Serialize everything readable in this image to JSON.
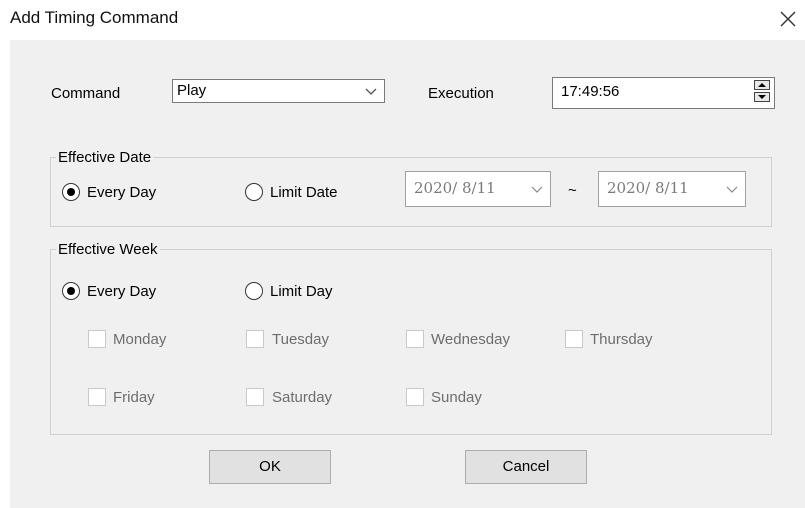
{
  "window": {
    "title": "Add Timing Command"
  },
  "command": {
    "label": "Command",
    "value": "Play"
  },
  "execution": {
    "label": "Execution",
    "value": "17:49:56"
  },
  "effective_date": {
    "legend": "Effective Date",
    "every_day_label": "Every Day",
    "limit_date_label": "Limit Date",
    "selected": "every_day",
    "start_date": "2020/  8/11",
    "separator": "~",
    "end_date": "2020/  8/11"
  },
  "effective_week": {
    "legend": "Effective Week",
    "every_day_label": "Every Day",
    "limit_day_label": "Limit Day",
    "selected": "every_day",
    "days": [
      "Monday",
      "Tuesday",
      "Wednesday",
      "Thursday",
      "Friday",
      "Saturday",
      "Sunday"
    ]
  },
  "buttons": {
    "ok": "OK",
    "cancel": "Cancel"
  }
}
